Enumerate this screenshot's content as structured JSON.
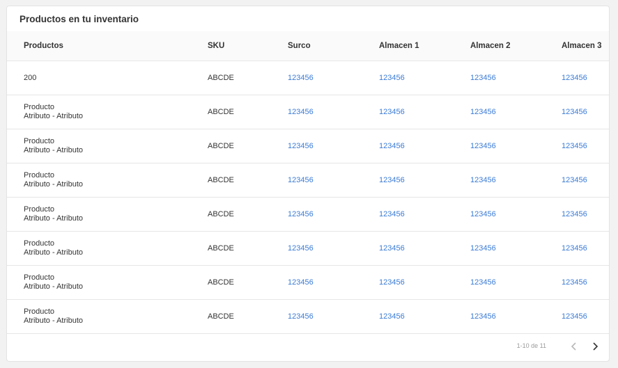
{
  "card": {
    "title": "Productos en tu inventario"
  },
  "table": {
    "headers": [
      "Productos",
      "SKU",
      "Surco",
      "Almacen 1",
      "Almacen 2",
      "Almacen 3"
    ],
    "rows": [
      {
        "product": "200",
        "attributes": "",
        "sku": "ABCDE",
        "surco": "123456",
        "almacen1": "123456",
        "almacen2": "123456",
        "almacen3": "123456"
      },
      {
        "product": "Producto",
        "attributes": "Atributo - Atributo",
        "sku": "ABCDE",
        "surco": "123456",
        "almacen1": "123456",
        "almacen2": "123456",
        "almacen3": "123456"
      },
      {
        "product": "Producto",
        "attributes": "Atributo - Atributo",
        "sku": "ABCDE",
        "surco": "123456",
        "almacen1": "123456",
        "almacen2": "123456",
        "almacen3": "123456"
      },
      {
        "product": "Producto",
        "attributes": "Atributo - Atributo",
        "sku": "ABCDE",
        "surco": "123456",
        "almacen1": "123456",
        "almacen2": "123456",
        "almacen3": "123456"
      },
      {
        "product": "Producto",
        "attributes": "Atributo - Atributo",
        "sku": "ABCDE",
        "surco": "123456",
        "almacen1": "123456",
        "almacen2": "123456",
        "almacen3": "123456"
      },
      {
        "product": "Producto",
        "attributes": "Atributo - Atributo",
        "sku": "ABCDE",
        "surco": "123456",
        "almacen1": "123456",
        "almacen2": "123456",
        "almacen3": "123456"
      },
      {
        "product": "Producto",
        "attributes": "Atributo - Atributo",
        "sku": "ABCDE",
        "surco": "123456",
        "almacen1": "123456",
        "almacen2": "123456",
        "almacen3": "123456"
      },
      {
        "product": "Producto",
        "attributes": "Atributo - Atributo",
        "sku": "ABCDE",
        "surco": "123456",
        "almacen1": "123456",
        "almacen2": "123456",
        "almacen3": "123456"
      }
    ]
  },
  "pagination": {
    "text": "1-10 de 11",
    "prev_icon": "chevron-left-icon",
    "next_icon": "chevron-right-icon"
  },
  "colors": {
    "link": "#3a7bd5",
    "header_bg": "#fafafa",
    "page_bg": "#f2f2f2",
    "border": "#e6e6e6"
  }
}
